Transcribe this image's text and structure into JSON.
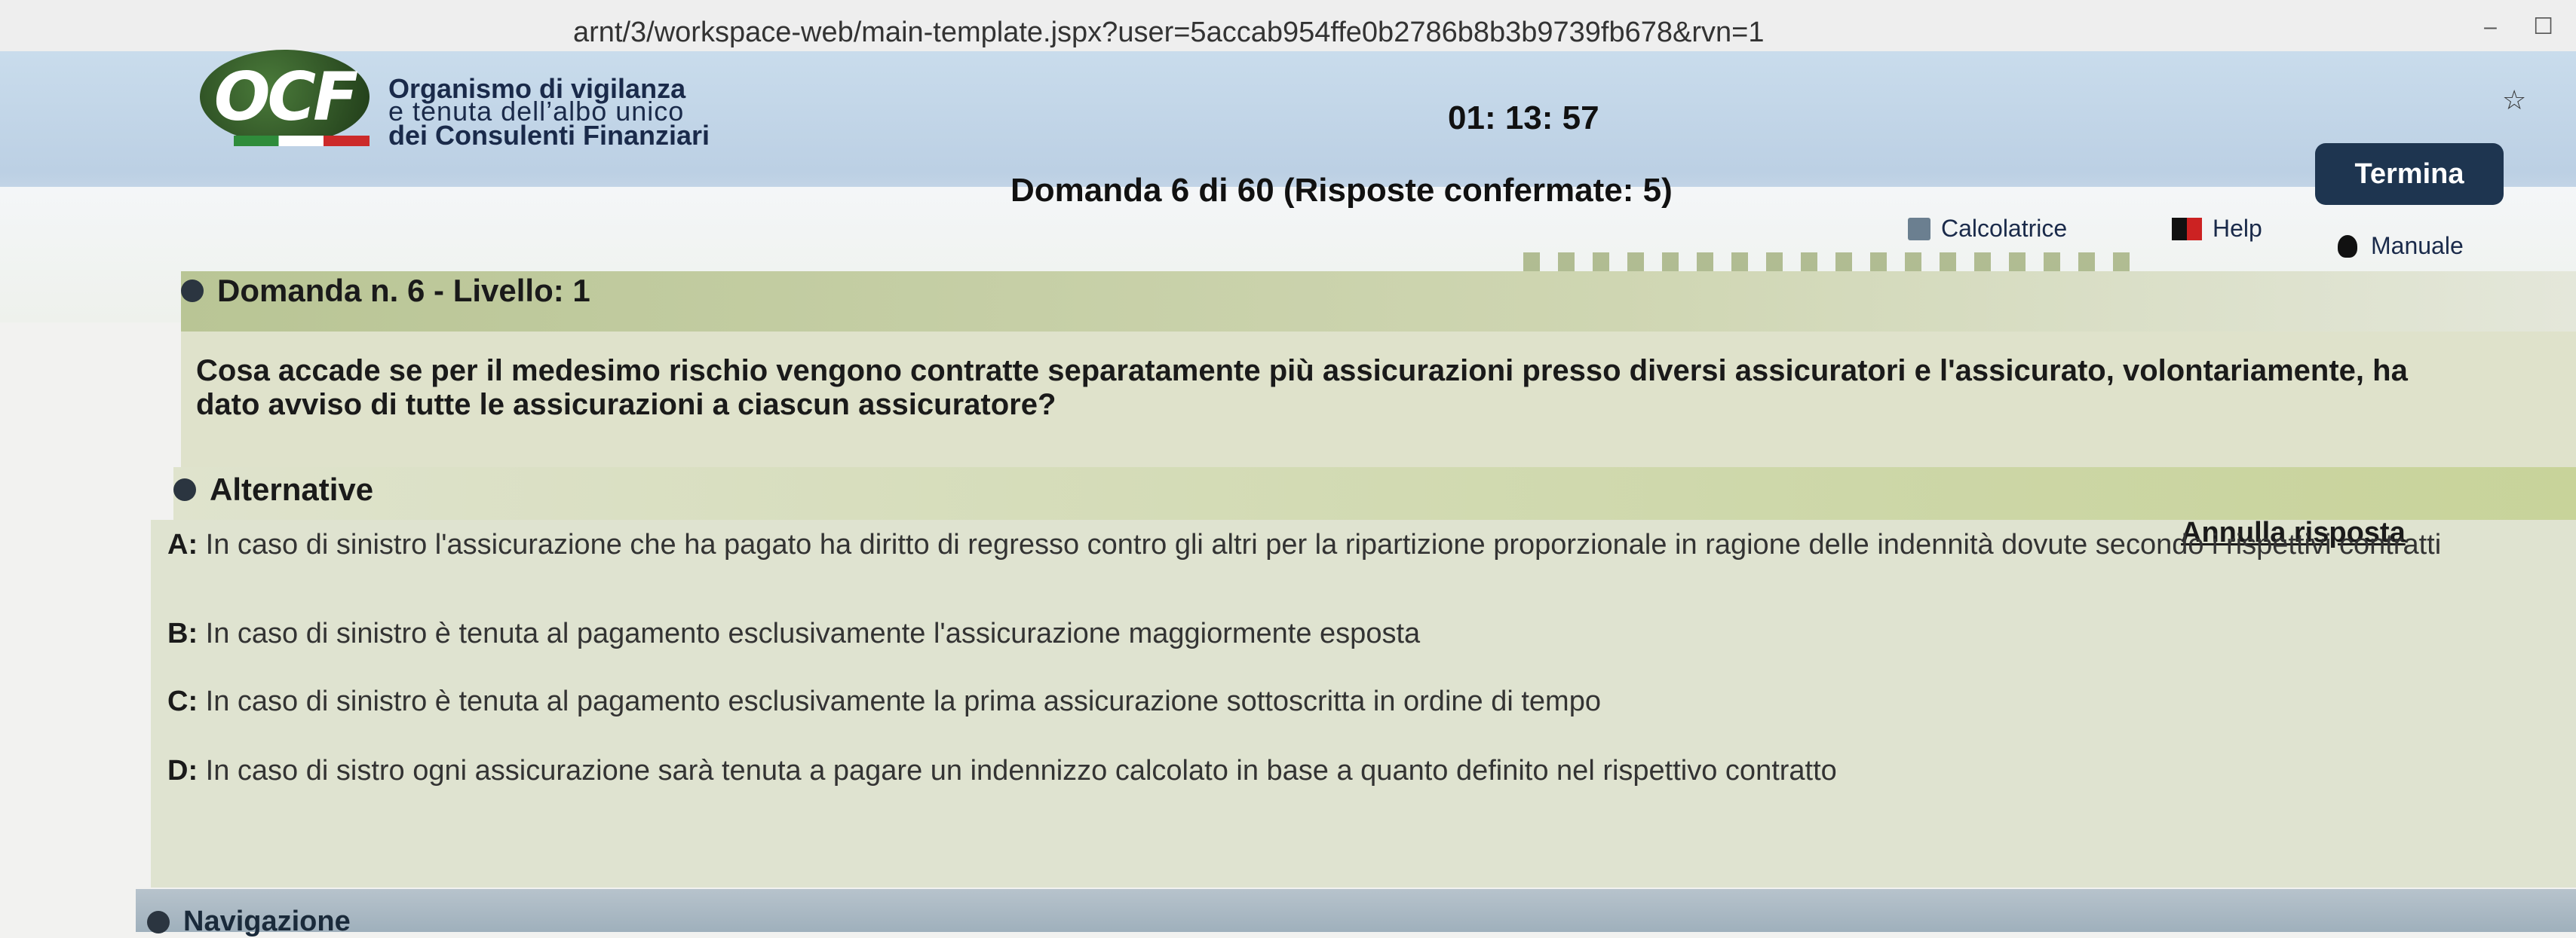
{
  "browser": {
    "url": "arnt/3/workspace-web/main-template.jspx?user=5accab954ffe0b2786b8b3b9739fb678&rvn=1",
    "minimize": "–",
    "maximize": "☐"
  },
  "header": {
    "logo_text": "OCF",
    "org_line1": "Organismo di vigilanza",
    "org_line2": "e tenuta dell’albo unico",
    "org_line3": "dei Consulenti Finanziari",
    "timer": "01: 13: 57",
    "star": "☆",
    "termina_label": "Termina",
    "question_progress": "Domanda 6 di 60 (Risposte confermate: 5)",
    "tools": {
      "calc_label": "Calcolatrice",
      "help_label": "Help",
      "manual_label": "Manuale"
    }
  },
  "question": {
    "title": "Domanda n. 6 - Livello: 1",
    "text": "Cosa accade se per il medesimo rischio vengono contratte separatamente più assicurazioni presso diversi assicuratori e l'assicurato, volontariamente, ha dato avviso di tutte le assicurazioni a ciascun assicuratore?"
  },
  "alternatives": {
    "title": "Alternative",
    "annulla_label": "Annulla risposta",
    "items": [
      {
        "letter": "A:",
        "text": " In caso di sinistro l'assicurazione che ha pagato ha diritto di regresso contro gli altri per la ripartizione proporzionale in ragione delle indennità dovute secondo i rispettivi contratti"
      },
      {
        "letter": "B:",
        "text": " In caso di sinistro è tenuta al pagamento esclusivamente l'assicurazione maggiormente esposta"
      },
      {
        "letter": "C:",
        "text": " In caso di sinistro è tenuta al pagamento esclusivamente la prima assicurazione sottoscritta in ordine di tempo"
      },
      {
        "letter": "D:",
        "text": " In caso di sistro ogni assicurazione sarà tenuta a pagare un indennizzo calcolato in base a quanto definito nel rispettivo contratto"
      }
    ]
  },
  "navigation": {
    "title": "Navigazione"
  },
  "colors": {
    "header_blue": "#c9dcec",
    "termina_bg": "#1e3550",
    "olive_bar": "#b9c595",
    "panel_bg": "#dfe3d0"
  }
}
